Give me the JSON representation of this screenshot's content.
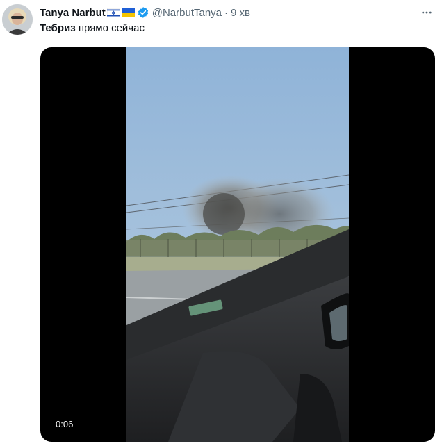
{
  "tweet": {
    "author_name": "Tanya Narbut",
    "flags": [
      "israel-flag-icon",
      "ukraine-flag-icon"
    ],
    "verified_icon": "verified-badge-icon",
    "handle": "@NarbutTanya",
    "separator": "·",
    "time": "9 хв",
    "more_icon": "more-options-icon",
    "text_bold": "Тебриз",
    "text_rest": " прямо сейчас",
    "video": {
      "duration": "0:06"
    }
  },
  "colors": {
    "verified_blue": "#1d9bf0",
    "secondary_text": "#536471",
    "video_background": "#000000"
  }
}
